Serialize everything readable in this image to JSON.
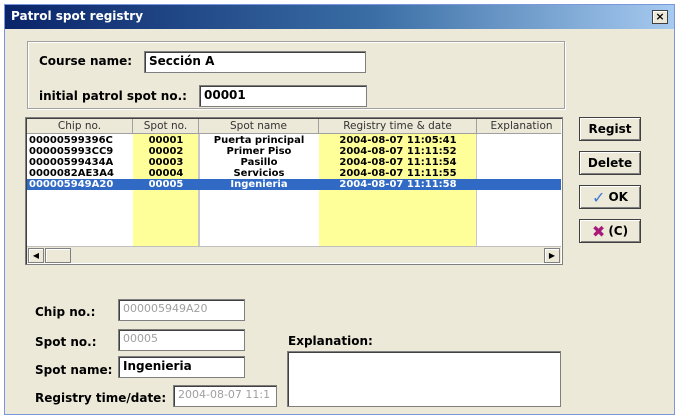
{
  "window": {
    "title": "Patrol spot registry",
    "close_label": "×"
  },
  "course": {
    "name_label": "Course name:",
    "name_value": "Sección A",
    "initial_label": "initial patrol spot no.:",
    "initial_value": "00001"
  },
  "grid": {
    "columns": [
      "Chip no.",
      "Spot no.",
      "Spot name",
      "Registry time & date",
      "Explanation"
    ],
    "rows": [
      {
        "chip": "00000599396C",
        "spot_no": "00001",
        "spot_name": "Puerta principal",
        "time": "2004-08-07 11:05:41",
        "explanation": "",
        "selected": false
      },
      {
        "chip": "000005993CC9",
        "spot_no": "00002",
        "spot_name": "Primer Piso",
        "time": "2004-08-07 11:11:52",
        "explanation": "",
        "selected": false
      },
      {
        "chip": "00000599434A",
        "spot_no": "00003",
        "spot_name": "Pasillo",
        "time": "2004-08-07 11:11:54",
        "explanation": "",
        "selected": false
      },
      {
        "chip": "0000082AE3A4",
        "spot_no": "00004",
        "spot_name": "Servicios",
        "time": "2004-08-07 11:11:55",
        "explanation": "",
        "selected": false
      },
      {
        "chip": "000005949A20",
        "spot_no": "00005",
        "spot_name": "Ingenieria",
        "time": "2004-08-07 11:11:58",
        "explanation": "",
        "selected": true
      }
    ],
    "scroll_left_icon": "arrow-left-icon",
    "scroll_right_icon": "arrow-right-icon",
    "highlight_color": "#ffff99",
    "selection_color": "#316ac5"
  },
  "buttons": {
    "regist": "Regist",
    "delete": "Delete",
    "ok": "OK",
    "cancel": "(C)",
    "ok_icon": "checkmark-icon",
    "cancel_icon": "x-icon"
  },
  "detail": {
    "chip_label": "Chip no.:",
    "chip_value": "000005949A20",
    "spot_label": "Spot no.:",
    "spot_value": "00005",
    "name_label": "Spot name:",
    "name_value": "Ingenieria",
    "time_label": "Registry time/date:",
    "time_value": "2004-08-07 11:1",
    "explanation_label": "Explanation:",
    "explanation_value": ""
  }
}
